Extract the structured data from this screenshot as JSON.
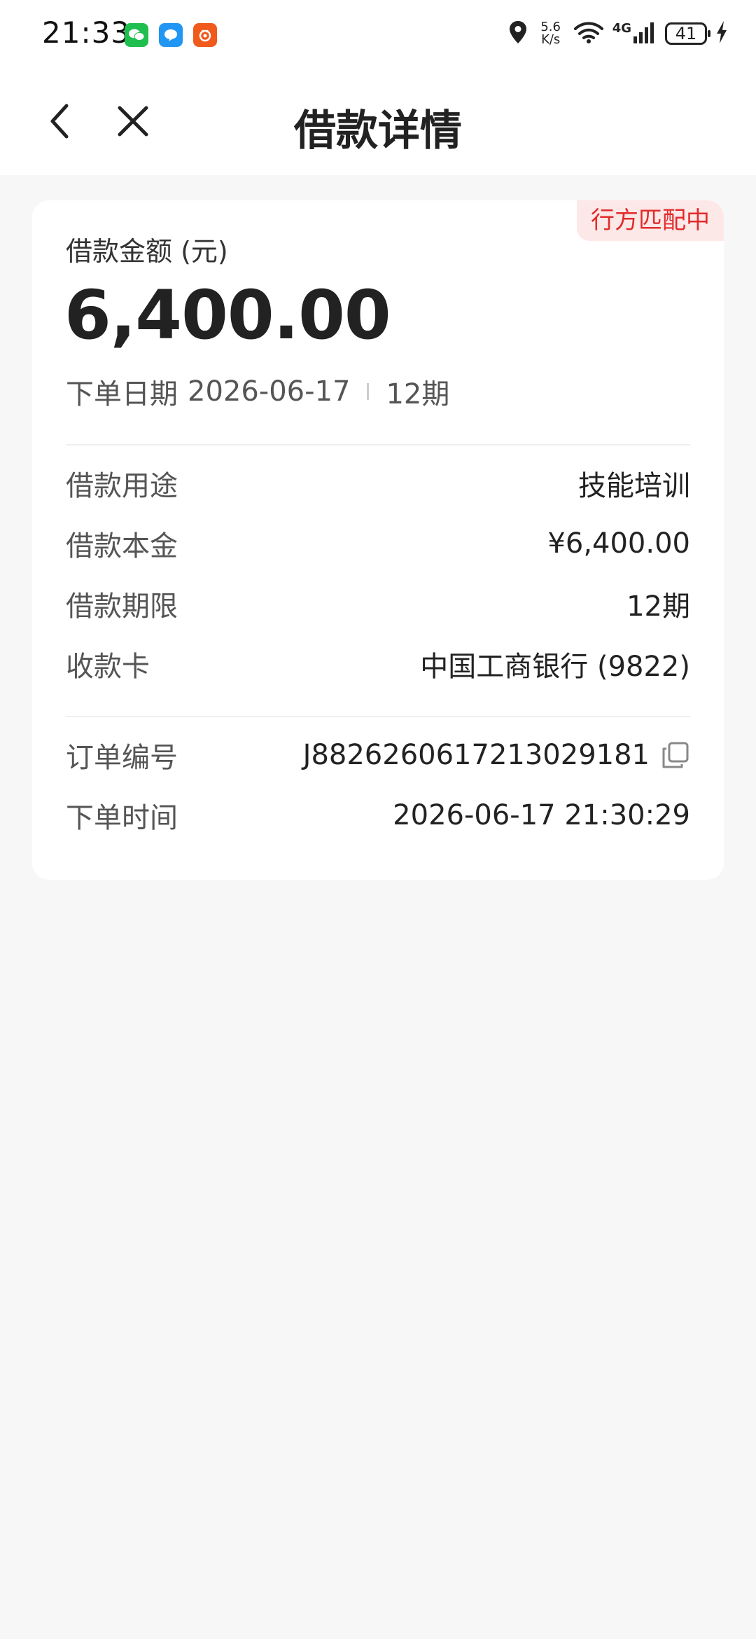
{
  "status_bar": {
    "time": "21:33",
    "net_speed_value": "5.6",
    "net_speed_unit": "K/s",
    "network_type": "4G",
    "battery": "41"
  },
  "header": {
    "title": "借款详情"
  },
  "card": {
    "status_badge": "行方匹配中",
    "amount_label": "借款金额 (元)",
    "amount": "6,400.00",
    "order_date_label": "下单日期",
    "order_date": "2026-06-17",
    "term_short": "12期",
    "details": [
      {
        "label": "借款用途",
        "value": "技能培训"
      },
      {
        "label": "借款本金",
        "value": "¥6,400.00"
      },
      {
        "label": "借款期限",
        "value": "12期"
      },
      {
        "label": "收款卡",
        "value": "中国工商银行 (9822)"
      }
    ],
    "order_info": [
      {
        "label": "订单编号",
        "value": "J8826260617213029181"
      },
      {
        "label": "下单时间",
        "value": "2026-06-17 21:30:29"
      }
    ]
  },
  "colors": {
    "badge_text": "#e12b2b",
    "badge_bg": "#fde8e8",
    "page_bg": "#f7f7f7"
  }
}
